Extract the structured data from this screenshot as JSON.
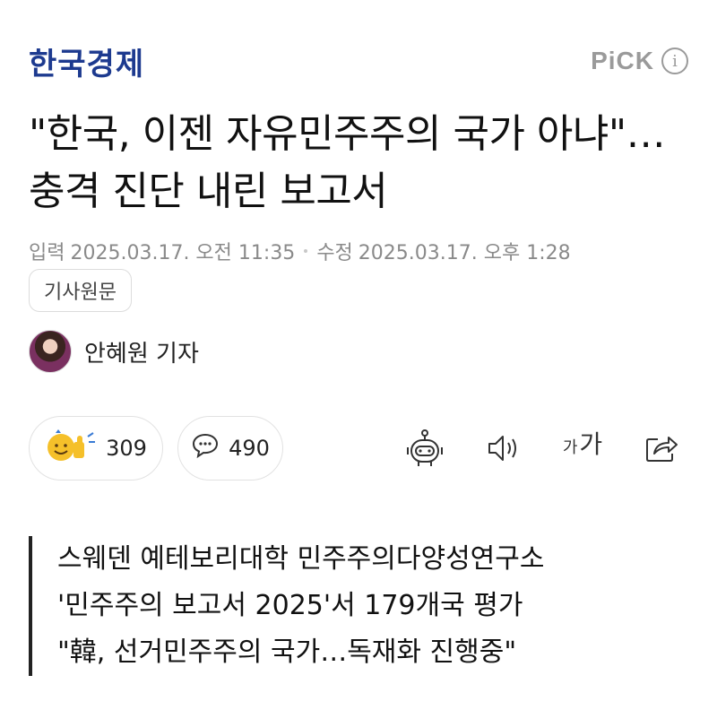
{
  "header": {
    "press_name": "한국경제",
    "pick_label": "PiCK",
    "info_symbol": "i"
  },
  "article": {
    "title": "\"한국, 이젠 자유민주주의 국가 아냐\"…충격 진단 내린 보고서",
    "published_label": "입력",
    "published_time": "2025.03.17. 오전 11:35",
    "modified_label": "수정",
    "modified_time": "2025.03.17. 오후 1:28",
    "original_button": "기사원문",
    "reporter": "안혜원 기자"
  },
  "actions": {
    "reaction_count": "309",
    "comment_count": "490",
    "font_size_small": "가",
    "font_size_large": "가"
  },
  "summary": {
    "lines": [
      "스웨덴 예테보리대학 민주주의다양성연구소",
      "'민주주의 보고서 2025'서 179개국 평가",
      "\"韓, 선거민주주의 국가…독재화 진행중\""
    ]
  },
  "colors": {
    "press_blue": "#1d3a8f",
    "muted_gray": "#8a8a8a",
    "reaction_yellow": "#f5c02a"
  },
  "icons": [
    "info-icon",
    "smile-reaction-icon",
    "comment-bubble-icon",
    "robot-summary-icon",
    "speaker-icon",
    "font-size-icon",
    "share-icon"
  ]
}
